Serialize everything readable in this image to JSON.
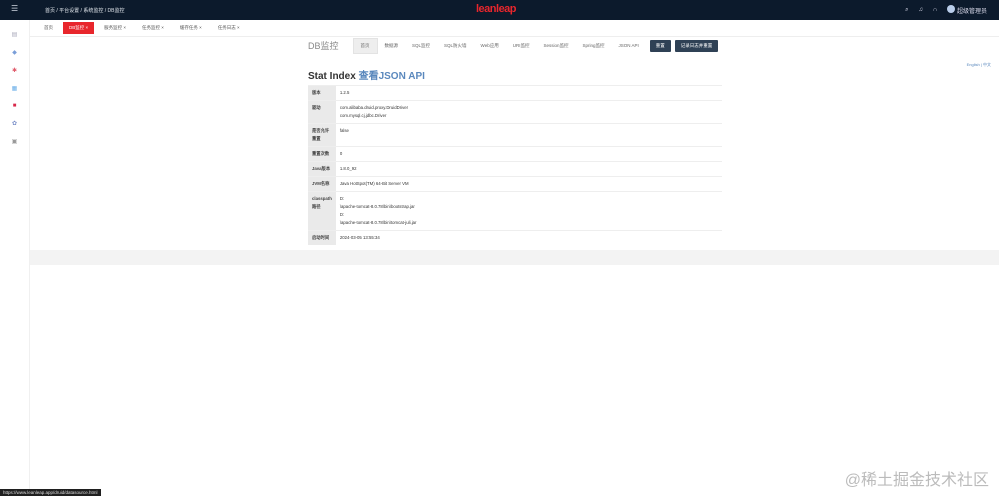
{
  "header": {
    "breadcrumb": "首页 / 平台设置 / 系统监控 / DB监控",
    "logo": "leanleap",
    "user": "超级管理员"
  },
  "tabs": [
    {
      "label": "首页"
    },
    {
      "label": "DB监控 ×"
    },
    {
      "label": "服务监控 ×"
    },
    {
      "label": "任务监控 ×"
    },
    {
      "label": "缓存任务 ×"
    },
    {
      "label": "任务日志 ×"
    }
  ],
  "druid": {
    "brand": "DB监控",
    "nav": [
      "首页",
      "数据源",
      "SQL监控",
      "SQL防火墙",
      "Web应用",
      "URI监控",
      "Session监控",
      "Spring监控",
      "JSON API"
    ],
    "buttons": [
      "重置",
      "记录日志并重置"
    ]
  },
  "title": "Stat Index",
  "title_link": "查看JSON API",
  "lang": "English | 中文",
  "rows": [
    {
      "k": "版本",
      "v": [
        "1.2.5"
      ]
    },
    {
      "k": "驱动",
      "v": [
        "com.alibaba.druid.proxy.DruidDriver",
        "com.mysql.cj.jdbc.Driver"
      ]
    },
    {
      "k": "是否允许重置",
      "v": [
        "false"
      ]
    },
    {
      "k": "重置次数",
      "v": [
        "0"
      ]
    },
    {
      "k": "Java版本",
      "v": [
        "1.8.0_92"
      ]
    },
    {
      "k": "JVM名称",
      "v": [
        "Java HotSpot(TM) 64-Bit Server VM"
      ]
    },
    {
      "k": "classpath路径",
      "v": [
        "D:",
        "\\apache-tomcat-8.0.78\\bin\\bootstrap.jar",
        "D:",
        "\\apache-tomcat-8.0.78\\bin\\tomcat-juli.jar"
      ]
    },
    {
      "k": "启动时间",
      "v": [
        "2024-03-05 13:55:34"
      ]
    }
  ],
  "status_url": "https://www.leanleap.app/druid/datasource.html",
  "watermark": "@稀土掘金技术社区"
}
